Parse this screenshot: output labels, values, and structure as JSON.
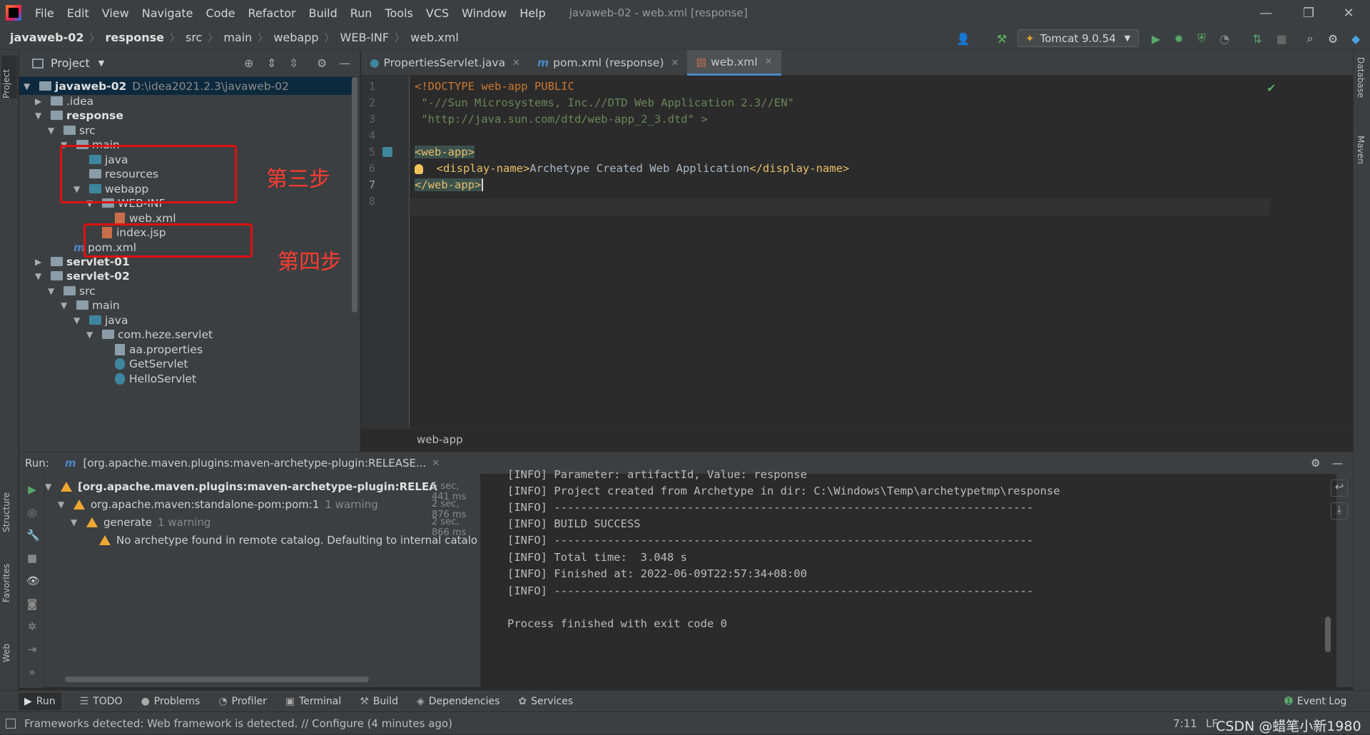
{
  "menu": {
    "items": [
      "File",
      "Edit",
      "View",
      "Navigate",
      "Code",
      "Refactor",
      "Build",
      "Run",
      "Tools",
      "VCS",
      "Window",
      "Help"
    ],
    "window_title": "javaweb-02 - web.xml [response]"
  },
  "navbar": {
    "crumbs": [
      "javaweb-02",
      "response",
      "src",
      "main",
      "webapp",
      "WEB-INF",
      "web.xml"
    ],
    "run_config": "Tomcat 9.0.54"
  },
  "project": {
    "title": "Project",
    "tree": [
      {
        "label": "javaweb-02",
        "path": "D:\\idea2021.2.3\\javaweb-02"
      },
      {
        "label": ".idea"
      },
      {
        "label": "response"
      },
      {
        "label": "src"
      },
      {
        "label": "main"
      },
      {
        "label": "java"
      },
      {
        "label": "resources"
      },
      {
        "label": "webapp"
      },
      {
        "label": "WEB-INF"
      },
      {
        "label": "web.xml"
      },
      {
        "label": "index.jsp"
      },
      {
        "label": "pom.xml"
      },
      {
        "label": "servlet-01"
      },
      {
        "label": "servlet-02"
      },
      {
        "label": "src"
      },
      {
        "label": "main"
      },
      {
        "label": "java"
      },
      {
        "label": "com.heze.servlet"
      },
      {
        "label": "aa.properties"
      },
      {
        "label": "GetServlet"
      },
      {
        "label": "HelloServlet"
      }
    ]
  },
  "annotations": {
    "step3": "第三步",
    "step4": "第四步"
  },
  "editor": {
    "tabs": [
      "PropertiesServlet.java",
      "pom.xml (response)",
      "web.xml"
    ],
    "line_numbers": [
      "1",
      "2",
      "3",
      "4",
      "5",
      "6",
      "7",
      "8"
    ],
    "lines": [
      "<!DOCTYPE web-app PUBLIC",
      " \"-//Sun Microsystems, Inc.//DTD Web Application 2.3//EN\"",
      " \"http://java.sun.com/dtd/web-app_2_3.dtd\" >",
      "",
      "<web-app>",
      "  <display-name>",
      "Archetype Created Web Application",
      "</display-name>",
      "</web-app>"
    ],
    "breadcrumb": "web-app"
  },
  "run": {
    "label": "Run:",
    "tab": "[org.apache.maven.plugins:maven-archetype-plugin:RELEASE...",
    "tree": [
      {
        "label": "[org.apache.maven.plugins:maven-archetype-plugin:RELEA",
        "time": "5 sec, 441 ms"
      },
      {
        "label": "org.apache.maven:standalone-pom:pom:1",
        "note": "1 warning",
        "time": "2 sec, 876 ms"
      },
      {
        "label": "generate",
        "note": "1 warning",
        "time": "2 sec, 866 ms"
      },
      {
        "label": "No archetype found in remote catalog. Defaulting to internal catalo"
      }
    ],
    "console": [
      "[INFO] Parameter: artifactId, Value: response",
      "[INFO] Project created from Archetype in dir: C:\\Windows\\Temp\\archetypetmp\\response",
      "[INFO] ------------------------------------------------------------------------",
      "[INFO] BUILD SUCCESS",
      "[INFO] ------------------------------------------------------------------------",
      "[INFO] Total time:  3.048 s",
      "[INFO] Finished at: 2022-06-09T22:57:34+08:00",
      "[INFO] ------------------------------------------------------------------------",
      "",
      "Process finished with exit code 0"
    ]
  },
  "toolwindows": [
    "Run",
    "TODO",
    "Problems",
    "Profiler",
    "Terminal",
    "Build",
    "Dependencies",
    "Services",
    "Event Log"
  ],
  "left_strip": [
    "Project",
    "Structure",
    "Favorites",
    "Web"
  ],
  "right_strip": [
    "Database",
    "Maven"
  ],
  "status": {
    "message": "Frameworks detected: Web framework is detected. // Configure (4 minutes ago)",
    "position": "7:11",
    "lf": "LF",
    "watermark": "CSDN @蜡笔小新1980"
  },
  "colors": {
    "accent": "#4a88c7",
    "annotation": "#e01010",
    "tag": "#e8bf6a",
    "string": "#6a8759"
  }
}
